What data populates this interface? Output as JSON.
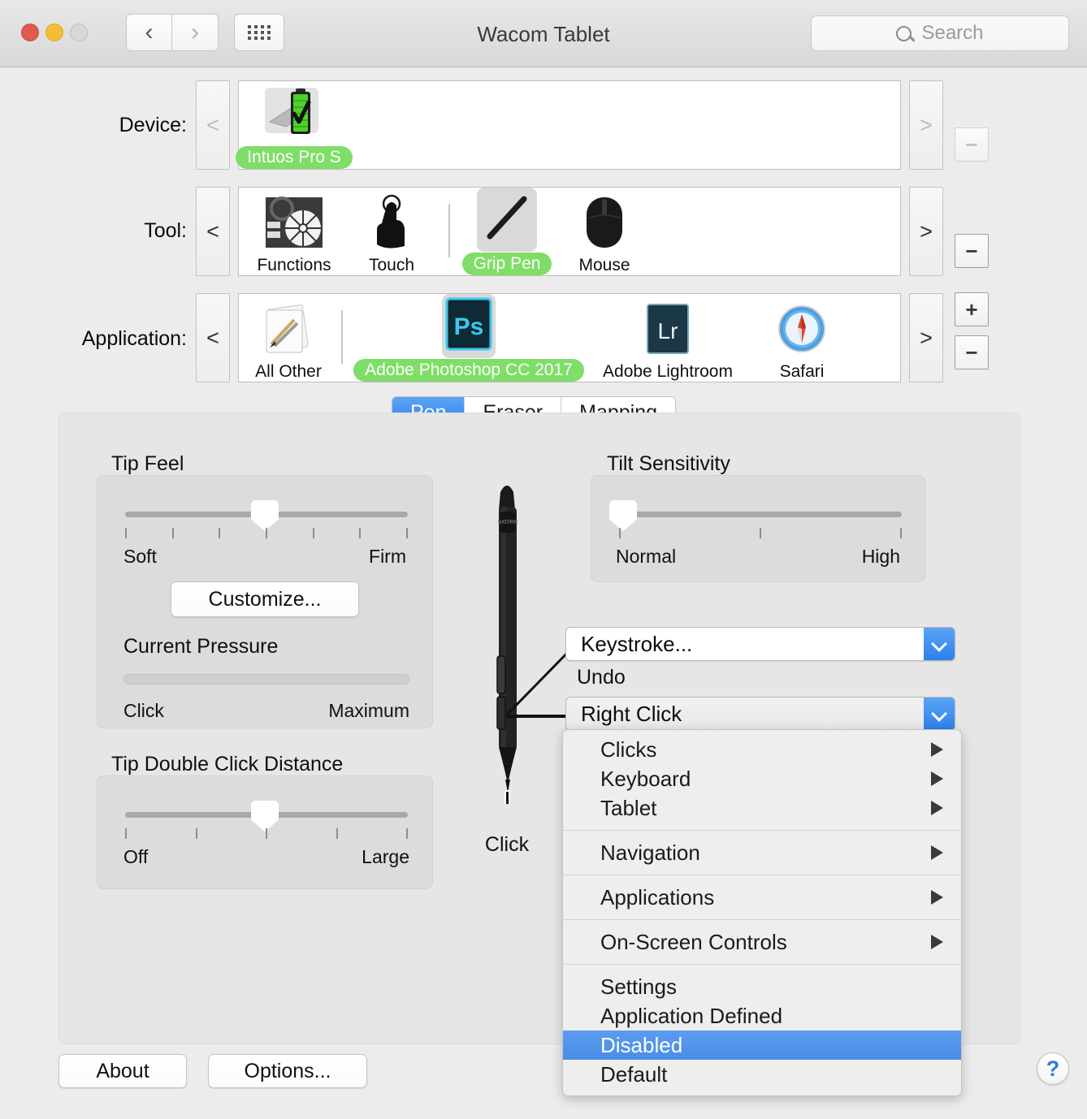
{
  "window": {
    "title": "Wacom Tablet",
    "search_placeholder": "Search",
    "back_glyph": "‹",
    "forward_glyph": "›"
  },
  "rows": {
    "device": {
      "label": "Device:",
      "prev_glyph": "<",
      "next_glyph": ">",
      "remove_glyph": "−",
      "items": [
        {
          "name": "Intuos Pro S",
          "icon": "tablet-battery-icon",
          "selected": true
        }
      ]
    },
    "tool": {
      "label": "Tool:",
      "prev_glyph": "<",
      "next_glyph": ">",
      "remove_glyph": "−",
      "items": [
        {
          "name": "Functions",
          "icon": "express-keys-icon",
          "selected": false
        },
        {
          "name": "Touch",
          "icon": "finger-touch-icon",
          "selected": false
        },
        {
          "name": "Grip Pen",
          "icon": "grip-pen-icon",
          "selected": true
        },
        {
          "name": "Mouse",
          "icon": "mouse-icon",
          "selected": false
        }
      ]
    },
    "application": {
      "label": "Application:",
      "prev_glyph": "<",
      "next_glyph": ">",
      "add_glyph": "+",
      "remove_glyph": "−",
      "items": [
        {
          "name": "All Other",
          "icon": "all-other-apps-icon",
          "selected": false
        },
        {
          "name": "Adobe Photoshop CC 2017",
          "icon": "photoshop-icon",
          "icon_text": "Ps",
          "selected": true
        },
        {
          "name": "Adobe Lightroom",
          "icon": "lightroom-icon",
          "icon_text": "Lr",
          "selected": false
        },
        {
          "name": "Safari",
          "icon": "safari-icon",
          "selected": false
        }
      ]
    }
  },
  "tabs": [
    {
      "label": "Pen",
      "active": true
    },
    {
      "label": "Eraser",
      "active": false
    },
    {
      "label": "Mapping",
      "active": false
    }
  ],
  "tip_feel": {
    "title": "Tip Feel",
    "min_label": "Soft",
    "max_label": "Firm",
    "value_percent": 50,
    "tick_count": 7,
    "customize_label": "Customize...",
    "current_pressure_title": "Current Pressure",
    "pressure_min_label": "Click",
    "pressure_max_label": "Maximum",
    "pressure_percent": 0
  },
  "tip_double_click": {
    "title": "Tip Double Click Distance",
    "min_label": "Off",
    "max_label": "Large",
    "value_percent": 50,
    "tick_count": 5
  },
  "tilt_sensitivity": {
    "title": "Tilt Sensitivity",
    "min_label": "Normal",
    "max_label": "High",
    "value_percent": 0,
    "tick_count": 3
  },
  "pen": {
    "tip_label": "Click",
    "icon": "wacom-grip-pen-illustration"
  },
  "button_popups": [
    {
      "name": "upper-side-switch",
      "value": "Keystroke...",
      "sub_label": "Undo",
      "state": "normal"
    },
    {
      "name": "lower-side-switch",
      "value": "Right Click",
      "sub_label": "",
      "state": "pressed"
    }
  ],
  "dropdown_menu": {
    "groups": [
      {
        "items": [
          {
            "label": "Clicks",
            "submenu": true,
            "selected": false
          },
          {
            "label": "Keyboard",
            "submenu": true,
            "selected": false
          },
          {
            "label": "Tablet",
            "submenu": true,
            "selected": false
          }
        ]
      },
      {
        "items": [
          {
            "label": "Navigation",
            "submenu": true,
            "selected": false
          }
        ]
      },
      {
        "items": [
          {
            "label": "Applications",
            "submenu": true,
            "selected": false
          }
        ]
      },
      {
        "items": [
          {
            "label": "On-Screen Controls",
            "submenu": true,
            "selected": false
          }
        ]
      },
      {
        "items": [
          {
            "label": "Settings",
            "submenu": false,
            "selected": false
          },
          {
            "label": "Application Defined",
            "submenu": false,
            "selected": false
          },
          {
            "label": "Disabled",
            "submenu": false,
            "selected": true
          },
          {
            "label": "Default",
            "submenu": false,
            "selected": false
          }
        ]
      }
    ]
  },
  "footer": {
    "about_label": "About",
    "options_label": "Options...",
    "help_glyph": "?"
  },
  "colors": {
    "accent_blue": "#2d80ec",
    "selection_green": "#7ede67",
    "menu_highlight": "#4a8de6",
    "window_bg": "#ececec",
    "panel_bg": "#e6e6e6"
  }
}
